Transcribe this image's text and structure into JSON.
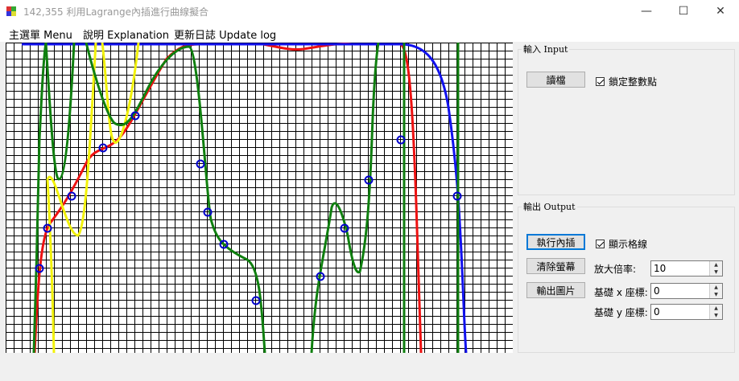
{
  "window": {
    "title": "142,355 利用Lagrange內插進行曲線擬合",
    "minimize_glyph": "—",
    "maximize_glyph": "☐",
    "close_glyph": "✕"
  },
  "menu": {
    "items": [
      "主選單 Menu",
      "說明 Explanation",
      "更新日誌 Update log"
    ]
  },
  "input_group": {
    "label": "輸入 Input",
    "load_button": "讀檔",
    "lock_checkbox": "鎖定整數點",
    "lock_checked": true
  },
  "output_group": {
    "label": "輸出 Output",
    "run_button": "執行內插",
    "clear_button": "清除螢幕",
    "export_button": "輸出圖片",
    "grid_checkbox": "顯示格線",
    "grid_checked": true,
    "zoom_label": "放大倍率:",
    "zoom_value": "10",
    "base_x_label": "基礎 x 座標:",
    "base_x_value": "0",
    "base_y_label": "基礎 y 座標:",
    "base_y_value": "0"
  },
  "plot": {
    "grid_visible": true,
    "colors": {
      "grid": "#000000",
      "red": "#ee1111",
      "blue": "#1111ee",
      "green": "#0f7f0f",
      "yellow": "#f2f20a",
      "points": "#0000cc"
    }
  }
}
